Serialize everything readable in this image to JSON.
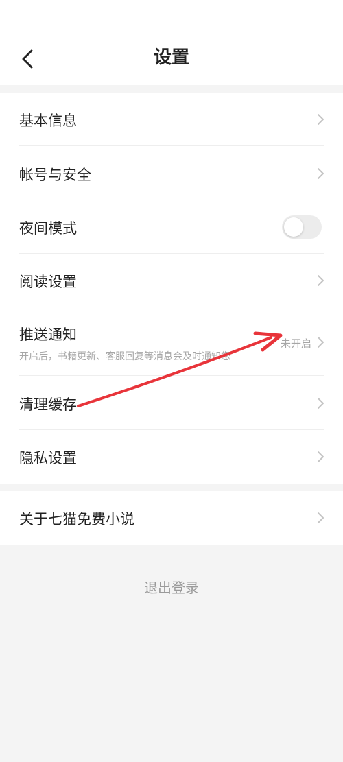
{
  "header": {
    "title": "设置",
    "back_icon": "chevron-left-icon"
  },
  "settings": {
    "basic_info": "基本信息",
    "account_security": "帐号与安全",
    "night_mode": "夜间模式",
    "night_mode_on": false,
    "reading_settings": "阅读设置",
    "push_notification": "推送通知",
    "push_notification_desc": "开启后，书籍更新、客服回复等消息会及时通知您",
    "push_notification_status": "未开启",
    "clear_cache": "清理缓存",
    "privacy_settings": "隐私设置"
  },
  "about": {
    "label": "关于七猫免费小说"
  },
  "logout_label": "退出登录",
  "colors": {
    "background": "#f4f4f4",
    "card": "#ffffff",
    "annotation_arrow": "#e8343a"
  }
}
